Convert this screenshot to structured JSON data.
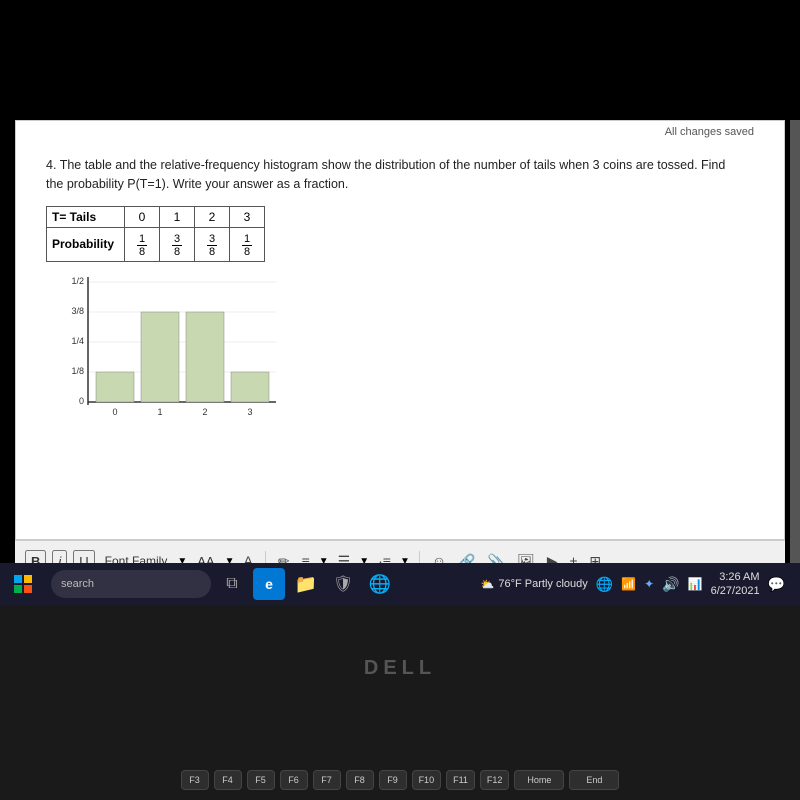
{
  "document": {
    "saved_status": "All changes saved",
    "question_number": "4.",
    "question_text": "The table and the relative-frequency histogram show the distribution of the number of tails when 3 coins are tossed.  Find the probability P(T=1).  Write your answer as a fraction.",
    "table": {
      "headers": [
        "T= Tails",
        "0",
        "1",
        "2",
        "3"
      ],
      "row_label": "Probability",
      "values": [
        "1/8",
        "3/8",
        "3/8",
        "1/8"
      ]
    },
    "histogram": {
      "y_labels": [
        "1/2",
        "3/8",
        "1/4",
        "1/8",
        "0"
      ],
      "x_labels": [
        "0",
        "1",
        "2",
        "3"
      ],
      "bars": [
        {
          "x": 0,
          "height_fraction": 0.25,
          "label": "1/8"
        },
        {
          "x": 1,
          "height_fraction": 0.75,
          "label": "3/8"
        },
        {
          "x": 2,
          "height_fraction": 0.75,
          "label": "3/8"
        },
        {
          "x": 3,
          "height_fraction": 0.25,
          "label": "1/8"
        }
      ]
    }
  },
  "toolbar": {
    "bold_label": "B",
    "italic_label": "i",
    "underline_label": "U",
    "font_family_label": "Font Family",
    "aa_label": "AA",
    "icons": [
      "✏️",
      "≡",
      "☰",
      "⊞",
      "😊",
      "🔗",
      "📎",
      "🖼️",
      "▶",
      "±",
      "⊞"
    ]
  },
  "taskbar": {
    "search_placeholder": "search",
    "weather": "76°F Partly cloudy",
    "time": "3:26 AM",
    "date": "6/27/2021"
  },
  "keyboard": {
    "rows": [
      [
        "F3",
        "F4",
        "F5",
        "F6",
        "F7",
        "F8",
        "F9",
        "F10",
        "F11",
        "F12",
        "Home",
        "End"
      ],
      [
        "search"
      ]
    ]
  },
  "dell_logo": "DELL"
}
